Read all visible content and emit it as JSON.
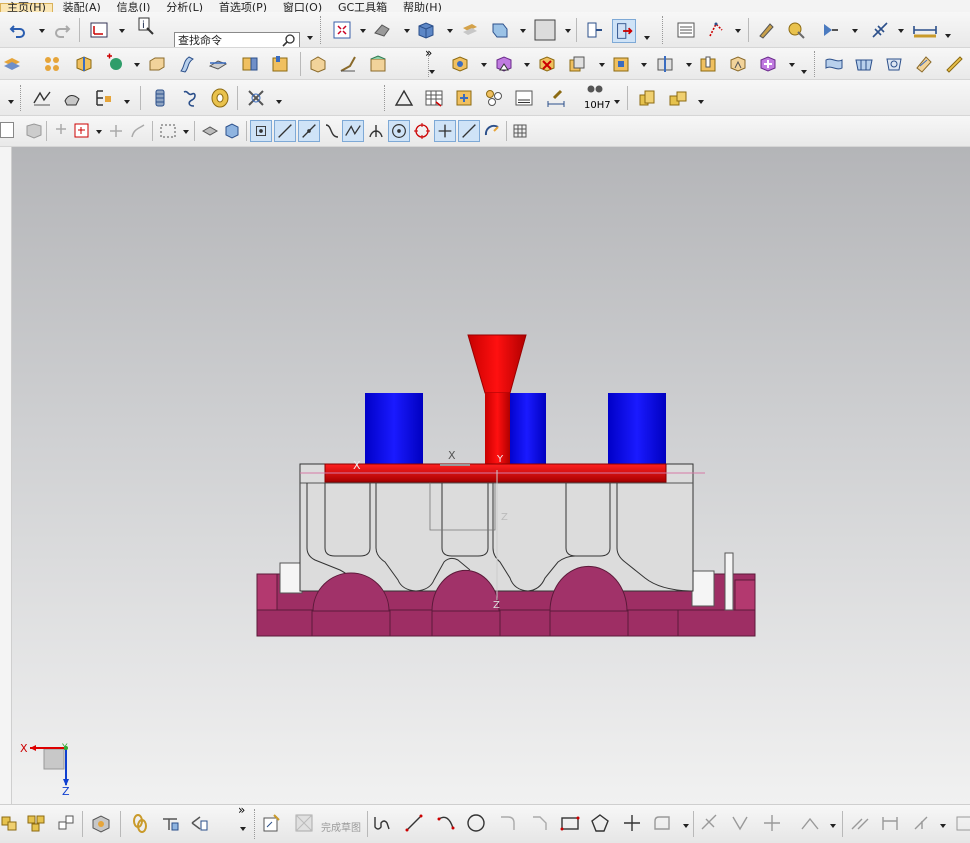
{
  "menu": {
    "items": [
      "主页(H)",
      "装配(A)",
      "信息(I)",
      "分析(L)",
      "首选项(P)",
      "窗口(O)",
      "GC工具箱",
      "帮助(H)"
    ]
  },
  "toolbar": {
    "search_placeholder": "查找命令",
    "overflow_glyph": "»",
    "tolerance_label": "10H7"
  },
  "sketch": {
    "finish_label": "完成草图"
  },
  "viewport": {
    "triad": {
      "x_label": "X",
      "y_label": "Y",
      "z_label": "Z"
    },
    "wcs_labels": {
      "x": "X",
      "x2": "X",
      "y": "Y",
      "z": "Z",
      "z2": "Z"
    }
  },
  "colors": {
    "nozzle_red": "#e00000",
    "insert_blue": "#1010ff",
    "base_magenta": "#9e2e64",
    "plate_gray": "#dcdcdc"
  }
}
